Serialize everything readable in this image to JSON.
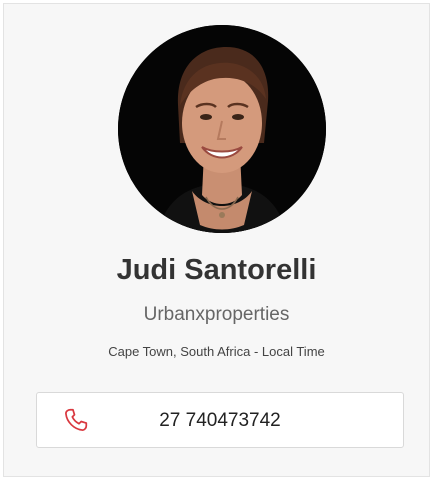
{
  "profile": {
    "name": "Judi Santorelli",
    "company": "Urbanxproperties",
    "location": "Cape Town, South Africa - Local Time",
    "phone": "27 740473742",
    "avatar_icon": "profile-photo",
    "phone_icon": "phone-icon"
  },
  "colors": {
    "card_background": "#f7f7f7",
    "name_text": "#333333",
    "phone_icon": "#d9383f"
  }
}
